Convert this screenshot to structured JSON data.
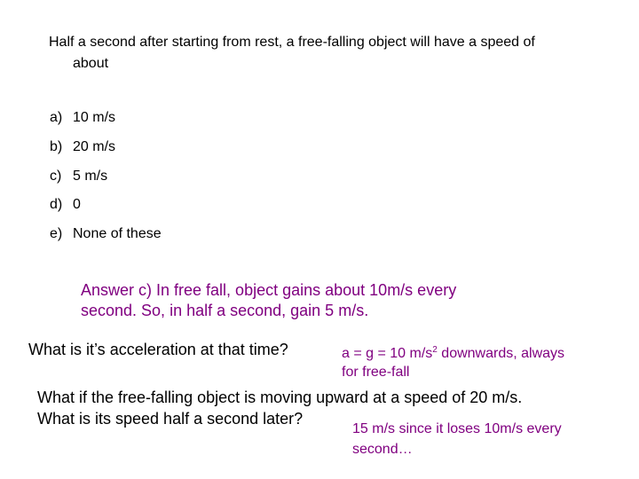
{
  "question": {
    "line1": "Half a second after starting from rest, a free-falling object will have a speed of",
    "line2": "about"
  },
  "options": [
    {
      "letter": "a)",
      "text": "10 m/s"
    },
    {
      "letter": "b)",
      "text": "20 m/s"
    },
    {
      "letter": "c)",
      "text": "5 m/s"
    },
    {
      "letter": "d)",
      "text": "0"
    },
    {
      "letter": "e)",
      "text": "None of these"
    }
  ],
  "answer": {
    "line1": "Answer c) In free fall, object gains about 10m/s every",
    "line2": "second. So, in half a second, gain 5 m/s."
  },
  "followup_acceleration": {
    "question": "What is it’s acceleration at that time?",
    "answer_prefix": "a = g = 10 m/s",
    "answer_sup": "2",
    "answer_suffix": " downwards, always",
    "answer_line2": "for free-fall"
  },
  "followup_upward": {
    "question_line1": "What if the free-falling object is moving upward at a speed of 20 m/s.",
    "question_line2": "What is its speed half a second later?",
    "answer_line1": "15 m/s since it loses 10m/s every",
    "answer_line2": "second…"
  },
  "colors": {
    "text": "#000000",
    "answer": "#800080",
    "background": "#ffffff"
  }
}
